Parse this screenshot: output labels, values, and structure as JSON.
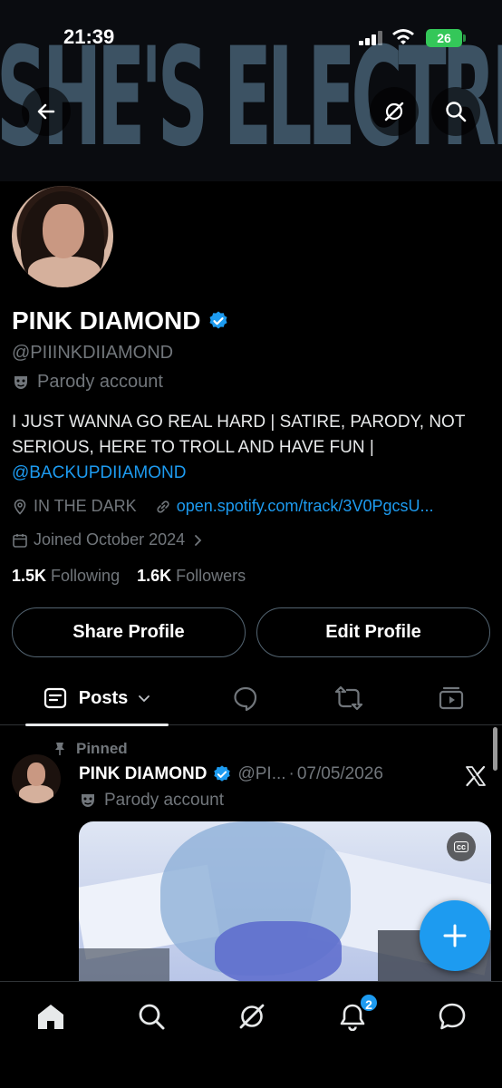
{
  "banner": {
    "text": "SHE'S ELECTRIC"
  },
  "status_bar": {
    "time": "21:39",
    "battery": "26"
  },
  "profile": {
    "name": "PINK DIAMOND",
    "handle": "@PIIINKDIIAMOND",
    "label": "Parody account",
    "bio_text": "I JUST WANNA GO REAL HARD | SATIRE, PARODY, NOT SERIOUS, HERE TO TROLL AND HAVE FUN |",
    "bio_link": "@BACKUPDIIAMOND",
    "location": "IN THE DARK",
    "website": "open.spotify.com/track/3V0PgcsU...",
    "joined": "Joined October 2024",
    "following_count": "1.5K",
    "following_label": "Following",
    "followers_count": "1.6K",
    "followers_label": "Followers"
  },
  "actions": {
    "share": "Share Profile",
    "edit": "Edit Profile"
  },
  "tabs": {
    "posts": "Posts"
  },
  "post": {
    "pinned_label": "Pinned",
    "author_name": "PINK DIAMOND",
    "author_handle": "@PI...",
    "separator": "·",
    "date": "07/05/2026",
    "label": "Parody account"
  },
  "notifications": {
    "badge": "2"
  },
  "colors": {
    "accent": "#1d9bf0",
    "background": "#000000",
    "secondary_text": "#71767b"
  },
  "icons": [
    "back-arrow-icon",
    "grok-icon",
    "search-icon",
    "verified-badge-icon",
    "parody-mask-icon",
    "location-icon",
    "link-icon",
    "calendar-icon",
    "chevron-right-icon",
    "posts-icon",
    "chevron-down-icon",
    "reply-icon",
    "retweet-icon",
    "media-icon",
    "pin-icon",
    "x-logo-icon",
    "cc-icon",
    "plus-icon",
    "home-icon",
    "notifications-icon",
    "messages-icon"
  ]
}
